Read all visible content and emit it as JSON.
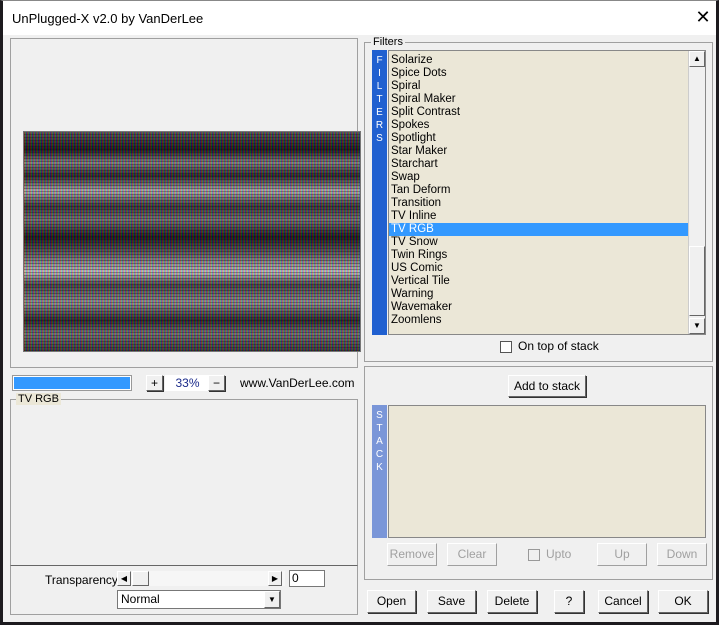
{
  "window": {
    "title": "UnPlugged-X v2.0 by VanDerLee",
    "close": "✕"
  },
  "preview": {
    "zoom": "33%",
    "plus": "+",
    "minus": "−",
    "website": "www.VanDerLee.com",
    "progress_percent": 100
  },
  "settings": {
    "group_title": "TV RGB",
    "transparency_label": "Transparency",
    "transparency_value": "0",
    "blend_mode": "Normal"
  },
  "filters": {
    "group_title": "Filters",
    "side_label": "FILTERS",
    "selected": "TV RGB",
    "items": [
      "Solarize",
      "Spice Dots",
      "Spiral",
      "Spiral Maker",
      "Split Contrast",
      "Spokes",
      "Spotlight",
      "Star Maker",
      "Starchart",
      "Swap",
      "Tan Deform",
      "Transition",
      "TV Inline",
      "TV RGB",
      "TV Snow",
      "Twin Rings",
      "US Comic",
      "Vertical Tile",
      "Warning",
      "Wavemaker",
      "Zoomlens"
    ],
    "on_top_label": "On top of stack",
    "on_top_checked": false
  },
  "stack": {
    "side_label": "STACK",
    "add_label": "Add to stack",
    "remove": "Remove",
    "clear": "Clear",
    "upto": "Upto",
    "up": "Up",
    "down": "Down"
  },
  "footer": {
    "open": "Open",
    "save": "Save",
    "delete": "Delete",
    "help": "?",
    "cancel": "Cancel",
    "ok": "OK"
  },
  "colors": {
    "accent": "#3399ff",
    "side_bar": "#2060d0",
    "list_bg": "#ebe7d7"
  }
}
